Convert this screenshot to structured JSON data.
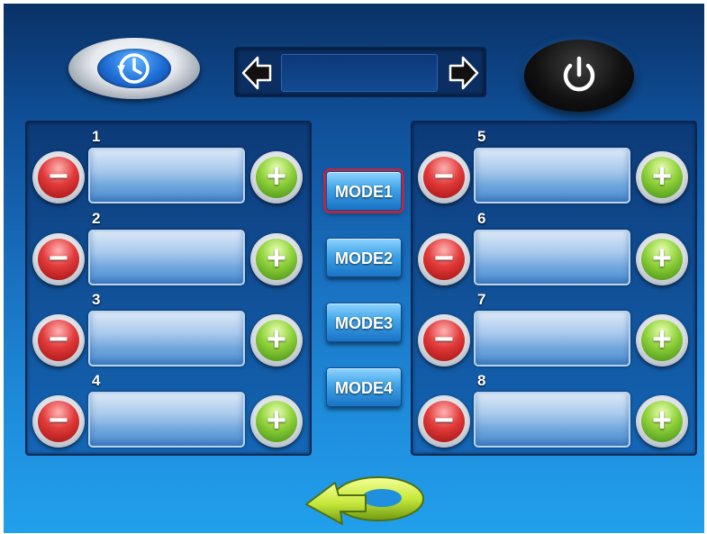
{
  "header": {
    "history_icon": "clock-history-icon",
    "selector_value": "",
    "prev_icon": "arrow-left-icon",
    "next_icon": "arrow-right-icon",
    "power_icon": "power-icon"
  },
  "channels": [
    {
      "number": "1",
      "value": ""
    },
    {
      "number": "2",
      "value": ""
    },
    {
      "number": "3",
      "value": ""
    },
    {
      "number": "4",
      "value": ""
    },
    {
      "number": "5",
      "value": ""
    },
    {
      "number": "6",
      "value": ""
    },
    {
      "number": "7",
      "value": ""
    },
    {
      "number": "8",
      "value": ""
    }
  ],
  "modes": [
    {
      "label": "MODE1",
      "active": true
    },
    {
      "label": "MODE2",
      "active": false
    },
    {
      "label": "MODE3",
      "active": false
    },
    {
      "label": "MODE4",
      "active": false
    }
  ],
  "controls": {
    "minus_icon": "minus-icon",
    "plus_icon": "plus-icon",
    "back_icon": "return-arrow-icon"
  },
  "colors": {
    "minus": "#e23a3a",
    "plus": "#8fd13a",
    "active_mode_outline": "#b02a4a",
    "background": "#1a74c4"
  }
}
